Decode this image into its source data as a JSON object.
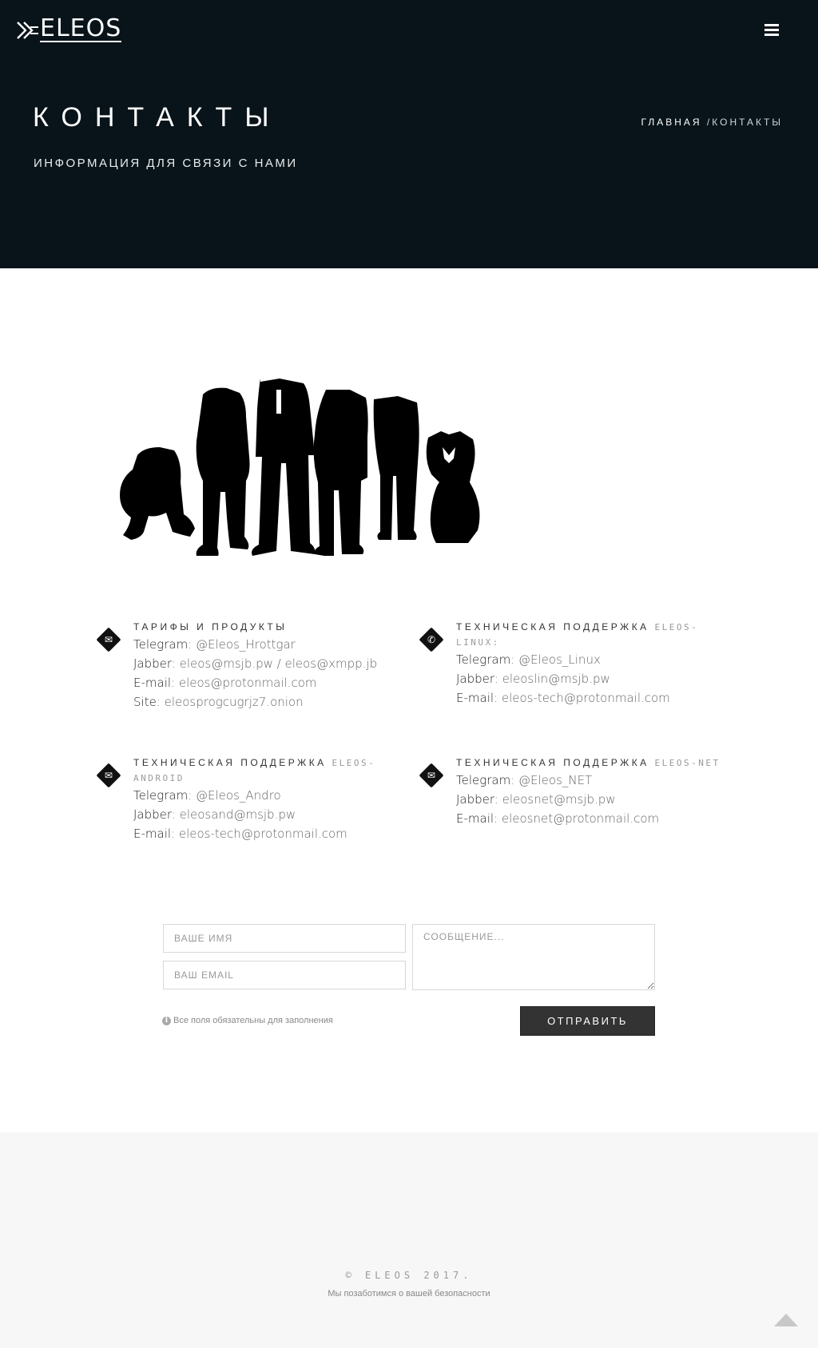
{
  "header": {
    "logo_text": "ELEOS",
    "title": "КОНТАКТЫ",
    "subtitle": "ИНФОРМАЦИЯ ДЛЯ СВЯЗИ С НАМИ",
    "breadcrumb_home": "ГЛАВНАЯ",
    "breadcrumb_sep": " /",
    "breadcrumb_current": "КОНТАКТЫ",
    "menu_icon": "hamburger-icon"
  },
  "contacts": [
    {
      "icon": "envelope-icon",
      "heading": "ТАРИФЫ И ПРОДУКТЫ",
      "heading_suffix": "",
      "lines": [
        {
          "k": "Telegram",
          "v": ": @Eleos_Hrottgar"
        },
        {
          "k": "Jabber",
          "v": ": eleos@msjb.pw / eleos@xmpp.jb"
        },
        {
          "k": "E-mail",
          "v": ": eleos@protonmail.com"
        },
        {
          "k": "Site",
          "v": ": eleosprogcugrjz7.onion"
        }
      ]
    },
    {
      "icon": "phone-icon",
      "heading": "ТЕХНИЧЕСКАЯ ПОДДЕРЖКА ",
      "heading_suffix": "ELEOS-LINUX:",
      "lines": [
        {
          "k": "Telegram",
          "v": ": @Eleos_Linux"
        },
        {
          "k": "Jabber",
          "v": ": eleoslin@msjb.pw"
        },
        {
          "k": "E-mail",
          "v": ": eleos-tech@protonmail.com"
        }
      ]
    },
    {
      "icon": "envelope-icon",
      "heading": "ТЕХНИЧЕСКАЯ ПОДДЕРЖКА ",
      "heading_suffix": "ELEOS-ANDROID",
      "lines": [
        {
          "k": "Telegram",
          "v": ": @Eleos_Andro"
        },
        {
          "k": "Jabber",
          "v": ": eleosand@msjb.pw"
        },
        {
          "k": "E-mail",
          "v": ": eleos-tech@protonmail.com"
        }
      ]
    },
    {
      "icon": "envelope-icon",
      "heading": "ТЕХНИЧЕСКАЯ ПОДДЕРЖКА ",
      "heading_suffix": "ELEOS-NET",
      "lines": [
        {
          "k": "Telegram",
          "v": ": @Eleos_NET"
        },
        {
          "k": "Jabber",
          "v": ": eleosnet@msjb.pw"
        },
        {
          "k": "E-mail",
          "v": ": eleosnet@protonmail.com"
        }
      ]
    }
  ],
  "form": {
    "name_placeholder": "ВАШЕ ИМЯ",
    "email_placeholder": "ВАШ EMAIL",
    "message_placeholder": "СООБЩЕНИЕ...",
    "note": "Все поля обязательны для заполнения",
    "submit_label": "ОТПРАВИТЬ"
  },
  "footer": {
    "copyright": "© ELEOS 2017.",
    "tagline": "Мы позаботимся о вашей безопасности"
  },
  "colors": {
    "hero_bg": "#08141a",
    "button_bg": "#333333",
    "footer_bg": "#f7f7f7"
  }
}
